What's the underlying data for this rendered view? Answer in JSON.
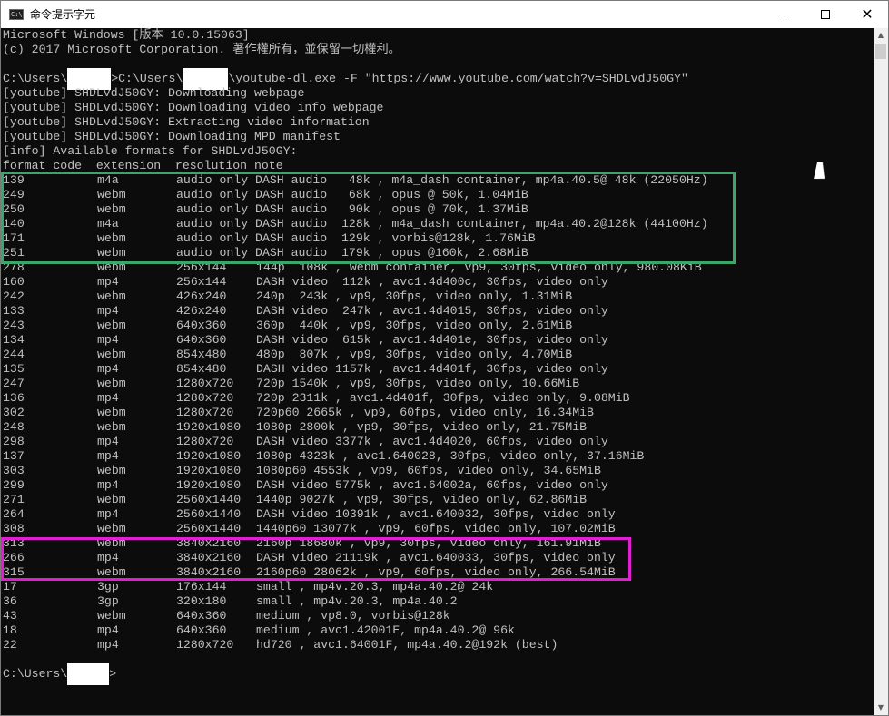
{
  "window": {
    "title": "命令提示字元",
    "icon_label": "C:\\",
    "icon": "console-icon",
    "buttons": {
      "minimize": "minimize-icon",
      "maximize": "maximize-icon",
      "close": "close-icon",
      "close_glyph": "✕"
    }
  },
  "console": {
    "header": [
      "Microsoft Windows [版本 10.0.15063]",
      "(c) 2017 Microsoft Corporation. 著作權所有，並保留一切權利。"
    ],
    "command_prefix": "C:\\Users\\",
    "command_mid": ">C:\\Users\\",
    "command_rest": "\\youtube-dl.exe -F \"https://www.youtube.com/watch?v=SHDLvdJ50GY\"",
    "log": [
      "[youtube] SHDLvdJ50GY: Downloading webpage",
      "[youtube] SHDLvdJ50GY: Downloading video info webpage",
      "[youtube] SHDLvdJ50GY: Extracting video information",
      "[youtube] SHDLvdJ50GY: Downloading MPD manifest",
      "[info] Available formats for SHDLvdJ50GY:"
    ],
    "table_header": "format code  extension  resolution note",
    "audio_formats": [
      {
        "code": "139",
        "ext": "m4a",
        "note": "audio only DASH audio   48k , m4a_dash container, mp4a.40.5@ 48k (22050Hz)"
      },
      {
        "code": "249",
        "ext": "webm",
        "note": "audio only DASH audio   68k , opus @ 50k, 1.04MiB"
      },
      {
        "code": "250",
        "ext": "webm",
        "note": "audio only DASH audio   90k , opus @ 70k, 1.37MiB"
      },
      {
        "code": "140",
        "ext": "m4a",
        "note": "audio only DASH audio  128k , m4a_dash container, mp4a.40.2@128k (44100Hz)"
      },
      {
        "code": "171",
        "ext": "webm",
        "note": "audio only DASH audio  129k , vorbis@128k, 1.76MiB"
      },
      {
        "code": "251",
        "ext": "webm",
        "note": "audio only DASH audio  179k , opus @160k, 2.68MiB"
      }
    ],
    "video_formats": [
      {
        "code": "278",
        "ext": "webm",
        "res": "256x144",
        "note": "144p  108k , webm container, vp9, 30fps, video only, 980.08KiB"
      },
      {
        "code": "160",
        "ext": "mp4",
        "res": "256x144",
        "note": "DASH video  112k , avc1.4d400c, 30fps, video only"
      },
      {
        "code": "242",
        "ext": "webm",
        "res": "426x240",
        "note": "240p  243k , vp9, 30fps, video only, 1.31MiB"
      },
      {
        "code": "133",
        "ext": "mp4",
        "res": "426x240",
        "note": "DASH video  247k , avc1.4d4015, 30fps, video only"
      },
      {
        "code": "243",
        "ext": "webm",
        "res": "640x360",
        "note": "360p  440k , vp9, 30fps, video only, 2.61MiB"
      },
      {
        "code": "134",
        "ext": "mp4",
        "res": "640x360",
        "note": "DASH video  615k , avc1.4d401e, 30fps, video only"
      },
      {
        "code": "244",
        "ext": "webm",
        "res": "854x480",
        "note": "480p  807k , vp9, 30fps, video only, 4.70MiB"
      },
      {
        "code": "135",
        "ext": "mp4",
        "res": "854x480",
        "note": "DASH video 1157k , avc1.4d401f, 30fps, video only"
      },
      {
        "code": "247",
        "ext": "webm",
        "res": "1280x720",
        "note": "720p 1540k , vp9, 30fps, video only, 10.66MiB"
      },
      {
        "code": "136",
        "ext": "mp4",
        "res": "1280x720",
        "note": "720p 2311k , avc1.4d401f, 30fps, video only, 9.08MiB"
      },
      {
        "code": "302",
        "ext": "webm",
        "res": "1280x720",
        "note": "720p60 2665k , vp9, 60fps, video only, 16.34MiB"
      },
      {
        "code": "248",
        "ext": "webm",
        "res": "1920x1080",
        "note": "1080p 2800k , vp9, 30fps, video only, 21.75MiB"
      },
      {
        "code": "298",
        "ext": "mp4",
        "res": "1280x720",
        "note": "DASH video 3377k , avc1.4d4020, 60fps, video only"
      },
      {
        "code": "137",
        "ext": "mp4",
        "res": "1920x1080",
        "note": "1080p 4323k , avc1.640028, 30fps, video only, 37.16MiB"
      },
      {
        "code": "303",
        "ext": "webm",
        "res": "1920x1080",
        "note": "1080p60 4553k , vp9, 60fps, video only, 34.65MiB"
      },
      {
        "code": "299",
        "ext": "mp4",
        "res": "1920x1080",
        "note": "DASH video 5775k , avc1.64002a, 60fps, video only"
      },
      {
        "code": "271",
        "ext": "webm",
        "res": "2560x1440",
        "note": "1440p 9027k , vp9, 30fps, video only, 62.86MiB"
      },
      {
        "code": "264",
        "ext": "mp4",
        "res": "2560x1440",
        "note": "DASH video 10391k , avc1.640032, 30fps, video only"
      },
      {
        "code": "308",
        "ext": "webm",
        "res": "2560x1440",
        "note": "1440p60 13077k , vp9, 60fps, video only, 107.02MiB"
      },
      {
        "code": "313",
        "ext": "webm",
        "res": "3840x2160",
        "note": "2160p 18680k , vp9, 30fps, video only, 161.91MiB"
      },
      {
        "code": "266",
        "ext": "mp4",
        "res": "3840x2160",
        "note": "DASH video 21119k , avc1.640033, 30fps, video only"
      },
      {
        "code": "315",
        "ext": "webm",
        "res": "3840x2160",
        "note": "2160p60 28062k , vp9, 60fps, video only, 266.54MiB"
      },
      {
        "code": "17",
        "ext": "3gp",
        "res": "176x144",
        "note": "small , mp4v.20.3, mp4a.40.2@ 24k"
      },
      {
        "code": "36",
        "ext": "3gp",
        "res": "320x180",
        "note": "small , mp4v.20.3, mp4a.40.2"
      },
      {
        "code": "43",
        "ext": "webm",
        "res": "640x360",
        "note": "medium , vp8.0, vorbis@128k"
      },
      {
        "code": "18",
        "ext": "mp4",
        "res": "640x360",
        "note": "medium , avc1.42001E, mp4a.40.2@ 96k"
      },
      {
        "code": "22",
        "ext": "mp4",
        "res": "1280x720",
        "note": "hd720 , avc1.64001F, mp4a.40.2@192k (best)"
      }
    ],
    "prompt_prefix": "C:\\Users\\",
    "prompt_suffix": ">"
  },
  "highlights": {
    "audio_box_color": "#3aa66a",
    "uhd_box_color": "#e020d0"
  },
  "scrollbar": {
    "up_glyph": "▲",
    "down_glyph": "▼"
  }
}
